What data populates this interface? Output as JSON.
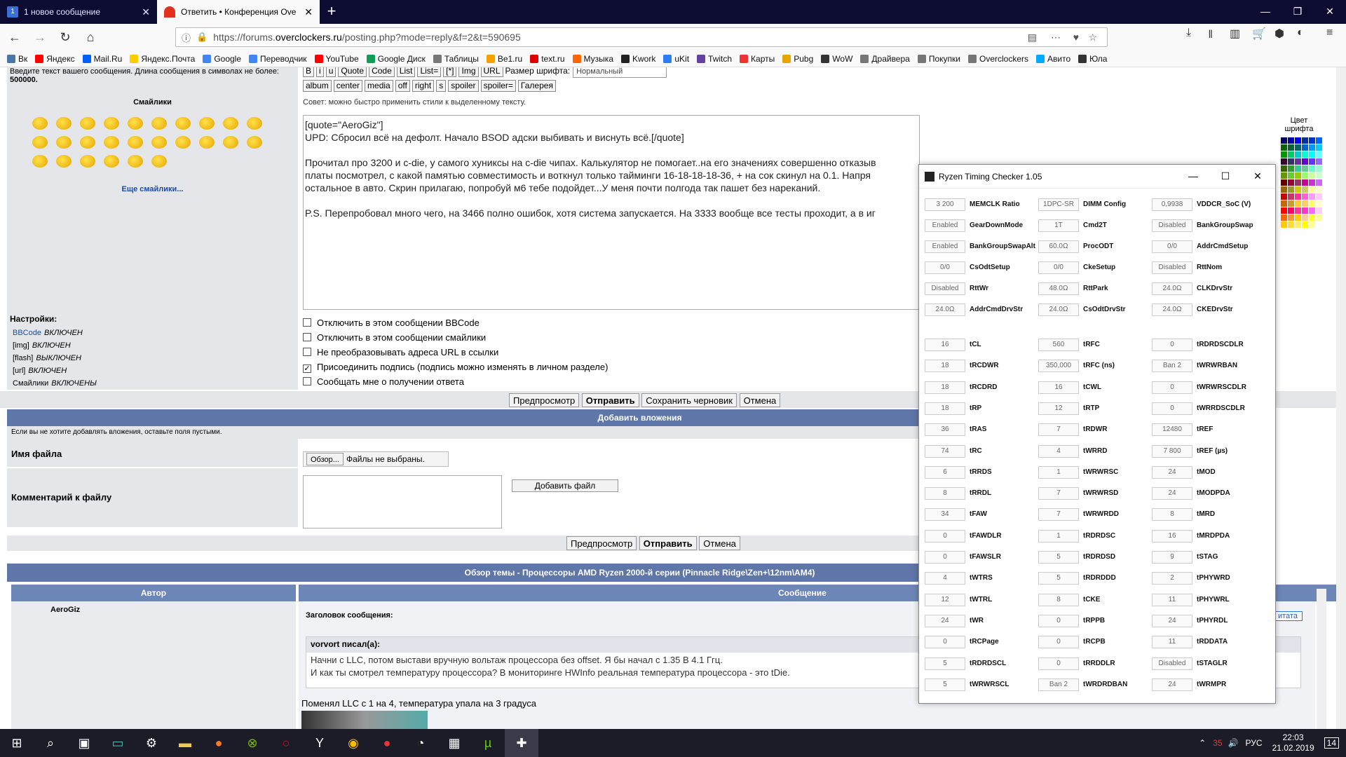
{
  "tabs": [
    {
      "title": "1 новое сообщение",
      "icon_text": "1",
      "icon_color": "#3a6fd8"
    },
    {
      "title": "Ответить • Конференция Ove",
      "icon_text": "",
      "icon_color": "#e0301e"
    }
  ],
  "nav": {
    "url_prefix": "https://forums.",
    "url_domain": "overclockers.ru",
    "url_suffix": "/posting.php?mode=reply&f=2&t=590695"
  },
  "bookmarks": [
    {
      "label": "Вк",
      "color": "#4a76a8"
    },
    {
      "label": "Яндекс",
      "color": "#ff0000"
    },
    {
      "label": "Mail.Ru",
      "color": "#005ff9"
    },
    {
      "label": "Яндекс.Почта",
      "color": "#ffcc00"
    },
    {
      "label": "Google",
      "color": "#4285f4"
    },
    {
      "label": "Переводчик",
      "color": "#4285f4"
    },
    {
      "label": "YouTube",
      "color": "#ff0000"
    },
    {
      "label": "Google Диск",
      "color": "#0f9d58"
    },
    {
      "label": "Таблицы",
      "color": "#777"
    },
    {
      "label": "Be1.ru",
      "color": "#f8a000"
    },
    {
      "label": "text.ru",
      "color": "#d00"
    },
    {
      "label": "Музыка",
      "color": "#f60"
    },
    {
      "label": "Kwork",
      "color": "#222"
    },
    {
      "label": "uKit",
      "color": "#2e7bf6"
    },
    {
      "label": "Twitch",
      "color": "#6441a5"
    },
    {
      "label": "Карты",
      "color": "#e33"
    },
    {
      "label": "Pubg",
      "color": "#e8a400"
    },
    {
      "label": "WoW",
      "color": "#333"
    },
    {
      "label": "Драйвера",
      "color": "#777"
    },
    {
      "label": "Покупки",
      "color": "#777"
    },
    {
      "label": "Overclockers",
      "color": "#777"
    },
    {
      "label": "Авито",
      "color": "#0af"
    },
    {
      "label": "Юла",
      "color": "#333"
    }
  ],
  "forum": {
    "hint": "Введите текст вашего сообщения. Длина сообщения в символах не более:",
    "hint_max": "500000.",
    "smiles_title": "Смайлики",
    "more_smiles": "Еще смайлики...",
    "toolbar": [
      "B",
      "i",
      "u",
      "Quote",
      "Code",
      "List",
      "List=",
      "[*]",
      "Img",
      "URL"
    ],
    "font_size_label": "Размер шрифта:",
    "font_size_value": "Нормальный",
    "toolbar2": [
      "album",
      "center",
      "media",
      "off",
      "right",
      "s",
      "spoiler",
      "spoiler=",
      "Галерея"
    ],
    "tip": "Совет: можно быстро применить стили к выделенному тексту.",
    "editor_lines": [
      "[quote=\"AeroGiz\"]",
      "UPD: Сбросил всё на дефолт. Начало BSOD адски выбивать и виснуть всё.[/quote]",
      "",
      "Прочитал про 3200 и c-die, у самого хуниксы на c-die чипах. Калькулятор не помогает..на его значениях совершенно отказыв",
      "платы посмотрел, с какой памятью совместимость и воткнул только тайминги 16-18-18-18-36, + на сок скинул на 0.1. Напря",
      "остальное в авто. Скрин прилагаю, попробуй м6 тебе подойдет...У меня почти полгода так пашет без нареканий.",
      "",
      "P.S. Перепробовал много чего, на 3466 полно ошибок, хотя система запускается. На 3333 вообще все тесты проходит, а в иг"
    ],
    "settings_title": "Настройки:",
    "settings": [
      {
        "name": "BBCode",
        "state": "ВКЛЮЧЕН"
      },
      {
        "name": "[img]",
        "state": "ВКЛЮЧЕН"
      },
      {
        "name": "[flash]",
        "state": "ВЫКЛЮЧЕН"
      },
      {
        "name": "[url]",
        "state": "ВКЛЮЧЕН"
      },
      {
        "name": "Смайлики",
        "state": "ВКЛЮЧЕНЫ"
      }
    ],
    "options": [
      {
        "label": "Отключить в этом сообщении BBCode",
        "checked": false
      },
      {
        "label": "Отключить в этом сообщении смайлики",
        "checked": false
      },
      {
        "label": "Не преобразовывать адреса URL в ссылки",
        "checked": false
      },
      {
        "label": "Присоединить подпись (подпись можно изменять в личном разделе)",
        "checked": true
      },
      {
        "label": "Сообщать мне о получении ответа",
        "checked": false
      }
    ],
    "buttons": {
      "preview": "Предпросмотр",
      "submit": "Отправить",
      "draft": "Сохранить черновик",
      "cancel": "Отмена"
    },
    "attach_title": "Добавить вложения",
    "attach_hint": "Если вы не хотите добавлять вложения, оставьте поля пустыми.",
    "file_label": "Имя файла",
    "browse": "Обзор...",
    "no_file": "Файлы не выбраны.",
    "comment_label": "Комментарий к файлу",
    "add_file": "Добавить файл",
    "topic_title": "Обзор темы - Процессоры AMD Ryzen 2000-й серии (Pinnacle Ridge\\Zen+\\12nm\\AM4)",
    "col_author": "Автор",
    "col_message": "Сообщение",
    "author": "AeroGiz",
    "msg_header": "Заголовок сообщения:",
    "quote_btn": "итата",
    "quote_author": "vorvort писал(а):",
    "quote_line1": "Начни с LLC, потом выстави вручную вольтаж процессора без offset. Я бы начал с 1.35 В 4.1 Ггц.",
    "quote_line2": "И как ты смотрел температуру процессора? В мониторинге HWInfo реальная температура процессора - это tDie.",
    "post_text": "Поменял LLC с 1 на 4, температура упала на 3 градуса",
    "color_label": "Цвет шрифта"
  },
  "rtc": {
    "title": "Ryzen Timing Checker 1.05",
    "top": [
      [
        [
          "3 200",
          "MEMCLK Ratio"
        ],
        [
          "1DPC-SR",
          "DIMM Config"
        ],
        [
          "0,9938",
          "VDDCR_SoC (V)"
        ]
      ],
      [
        [
          "Enabled",
          "GearDownMode"
        ],
        [
          "1T",
          "Cmd2T"
        ],
        [
          "Disabled",
          "BankGroupSwap"
        ]
      ],
      [
        [
          "Enabled",
          "BankGroupSwapAlt"
        ],
        [
          "60.0Ω",
          "ProcODT"
        ],
        [
          "0/0",
          "AddrCmdSetup"
        ]
      ],
      [
        [
          "0/0",
          "CsOdtSetup"
        ],
        [
          "0/0",
          "CkeSetup"
        ],
        [
          "Disabled",
          "RttNom"
        ]
      ],
      [
        [
          "Disabled",
          "RttWr"
        ],
        [
          "48.0Ω",
          "RttPark"
        ],
        [
          "24.0Ω",
          "CLKDrvStr"
        ]
      ],
      [
        [
          "24.0Ω",
          "AddrCmdDrvStr"
        ],
        [
          "24.0Ω",
          "CsOdtDrvStr"
        ],
        [
          "24.0Ω",
          "CKEDrvStr"
        ]
      ]
    ],
    "timings": [
      [
        [
          "16",
          "tCL"
        ],
        [
          "560",
          "tRFC"
        ],
        [
          "0",
          "tRDRDSCDLR"
        ]
      ],
      [
        [
          "18",
          "tRCDWR"
        ],
        [
          "350,000",
          "tRFC (ns)"
        ],
        [
          "Ban 2",
          "tWRWRBAN"
        ]
      ],
      [
        [
          "18",
          "tRCDRD"
        ],
        [
          "16",
          "tCWL"
        ],
        [
          "0",
          "tWRWRSCDLR"
        ]
      ],
      [
        [
          "18",
          "tRP"
        ],
        [
          "12",
          "tRTP"
        ],
        [
          "0",
          "tWRRDSCDLR"
        ]
      ],
      [
        [
          "36",
          "tRAS"
        ],
        [
          "7",
          "tRDWR"
        ],
        [
          "12480",
          "tREF"
        ]
      ],
      [
        [
          "74",
          "tRC"
        ],
        [
          "4",
          "tWRRD"
        ],
        [
          "7 800",
          "tREF (µs)"
        ]
      ],
      [
        [
          "6",
          "tRRDS"
        ],
        [
          "1",
          "tWRWRSC"
        ],
        [
          "24",
          "tMOD"
        ]
      ],
      [
        [
          "8",
          "tRRDL"
        ],
        [
          "7",
          "tWRWRSD"
        ],
        [
          "24",
          "tMODPDA"
        ]
      ],
      [
        [
          "34",
          "tFAW"
        ],
        [
          "7",
          "tWRWRDD"
        ],
        [
          "8",
          "tMRD"
        ]
      ],
      [
        [
          "0",
          "tFAWDLR"
        ],
        [
          "1",
          "tRDRDSC"
        ],
        [
          "16",
          "tMRDPDA"
        ]
      ],
      [
        [
          "0",
          "tFAWSLR"
        ],
        [
          "5",
          "tRDRDSD"
        ],
        [
          "9",
          "tSTAG"
        ]
      ],
      [
        [
          "4",
          "tWTRS"
        ],
        [
          "5",
          "tRDRDDD"
        ],
        [
          "2",
          "tPHYWRD"
        ]
      ],
      [
        [
          "12",
          "tWTRL"
        ],
        [
          "8",
          "tCKE"
        ],
        [
          "11",
          "tPHYWRL"
        ]
      ],
      [
        [
          "24",
          "tWR"
        ],
        [
          "0",
          "tRPPB"
        ],
        [
          "24",
          "tPHYRDL"
        ]
      ],
      [
        [
          "0",
          "tRCPage"
        ],
        [
          "0",
          "tRCPB"
        ],
        [
          "11",
          "tRDDATA"
        ]
      ],
      [
        [
          "5",
          "tRDRDSCL"
        ],
        [
          "0",
          "tRRDDLR"
        ],
        [
          "Disabled",
          "tSTAGLR"
        ]
      ],
      [
        [
          "5",
          "tWRWRSCL"
        ],
        [
          "Ban 2",
          "tWRDRDBAN"
        ],
        [
          "24",
          "tWRMPR"
        ]
      ]
    ]
  },
  "tray": {
    "lang": "РУС",
    "time": "22:03",
    "date": "21.02.2019",
    "notify": "14",
    "battery": "35"
  }
}
